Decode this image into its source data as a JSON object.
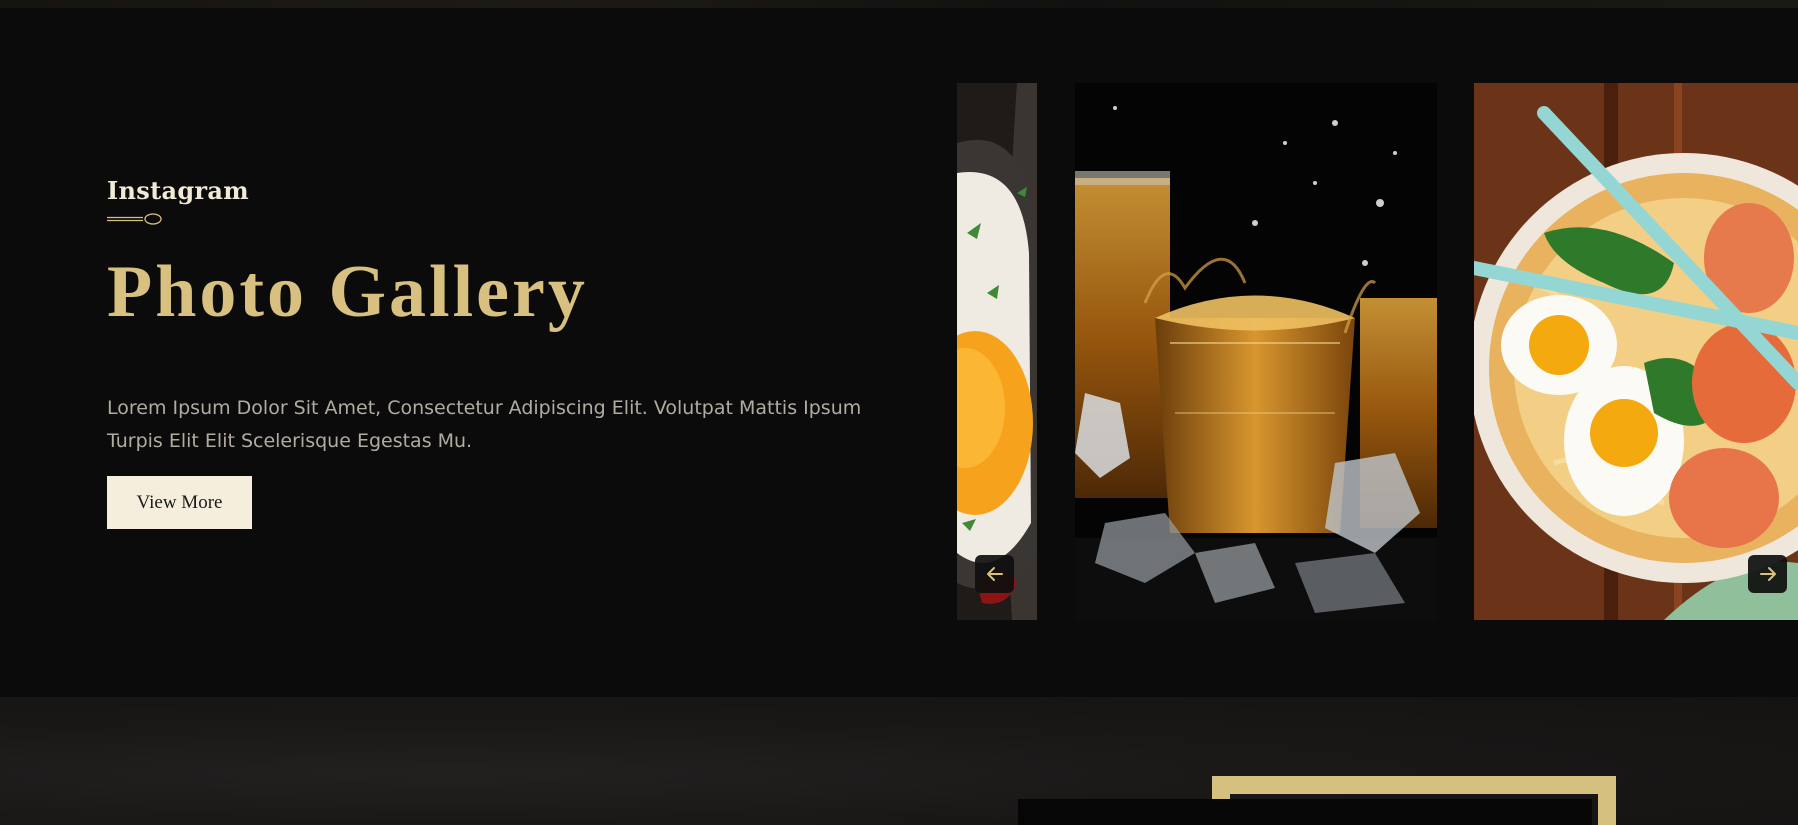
{
  "gallery": {
    "eyebrow": "Instagram",
    "title": "Photo Gallery",
    "description": "Lorem Ipsum Dolor Sit Amet, Consectetur Adipiscing Elit. Volutpat Mattis Ipsum Turpis Elit Elit Scelerisque Egestas Mu.",
    "button_label": "View More",
    "photos": [
      {
        "subject": "fried-egg-dish"
      },
      {
        "subject": "whiskey-glasses-with-ice"
      },
      {
        "subject": "ramen-bowl-with-eggs-and-shrimp"
      }
    ],
    "nav": {
      "prev_icon": "arrow-left-icon",
      "next_icon": "arrow-right-icon"
    }
  },
  "colors": {
    "background": "#0b0b0b",
    "accent_gold": "#d8c081",
    "button_bg": "#f5eedd",
    "body_text": "#b2aca0"
  }
}
